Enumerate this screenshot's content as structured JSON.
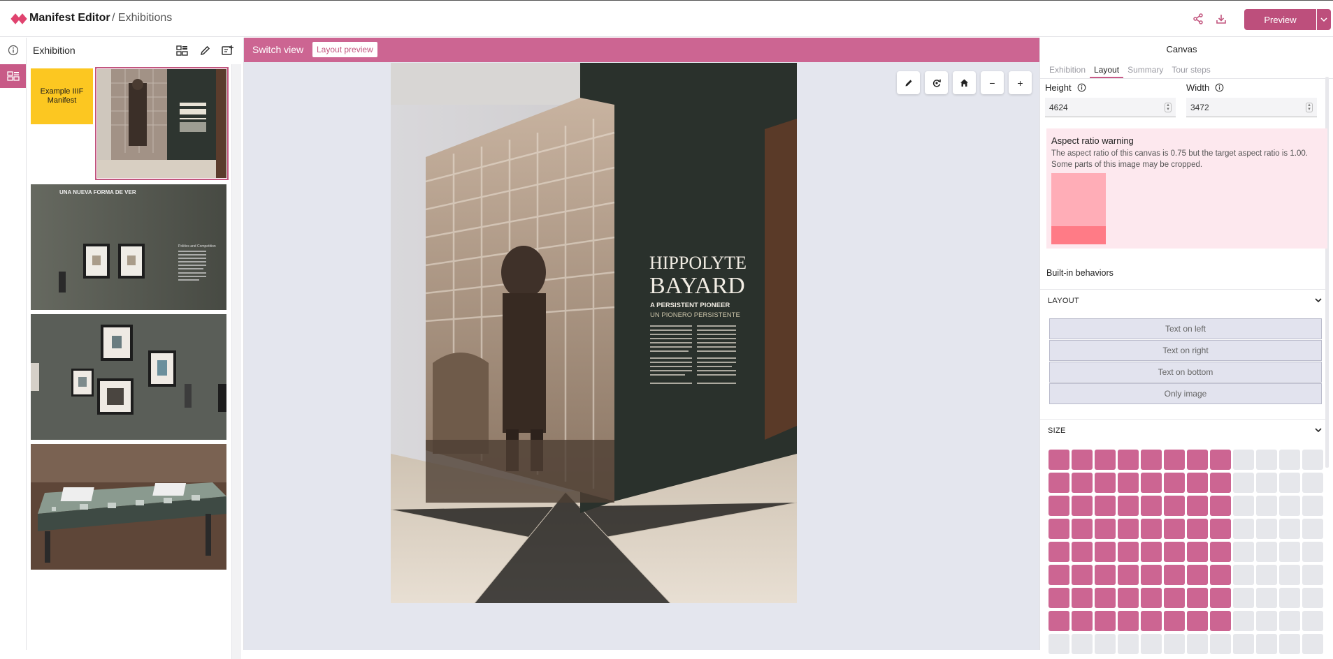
{
  "header": {
    "app_title": "Manifest Editor",
    "breadcrumb": "/ Exhibitions",
    "share_icon": "share-icon",
    "download_icon": "download-icon",
    "preview_label": "Preview",
    "accent": "#bd4f7c"
  },
  "rail": {
    "info_icon": "info-icon",
    "grid_icon": "grid-icon"
  },
  "left_panel": {
    "title": "Exhibition",
    "manifest_card_label": "Example IIIF Manifest",
    "manifest_card_color": "#fcc721",
    "thumbnails": [
      {
        "name": "hippolyte-bayard-wall"
      },
      {
        "name": "una-nueva-forma-de-ver-wall"
      },
      {
        "name": "framed-prints-wall"
      },
      {
        "name": "display-case"
      }
    ],
    "thumb2_text": {
      "line1": "UNA NUEVA FORMA DE VER",
      "line2": "Politics and Competition"
    }
  },
  "canvas": {
    "switch_view": "Switch view",
    "layout_preview": "Layout preview",
    "photo_text": {
      "line1": "HIPPOLYTE",
      "line2": "BAYARD",
      "line3": "A PERSISTENT PIONEER",
      "line4": "UN PIONERO PERSISTENTE"
    },
    "tools": [
      "edit-icon",
      "rotate-icon",
      "home-icon",
      "zoom-out-icon",
      "zoom-in-icon"
    ],
    "zoom_out_glyph": "−",
    "zoom_in_glyph": "+"
  },
  "right_panel": {
    "title": "Canvas",
    "tabs": [
      {
        "label": "Exhibition",
        "active": false
      },
      {
        "label": "Layout",
        "active": true
      },
      {
        "label": "Summary",
        "active": false
      },
      {
        "label": "Tour steps",
        "active": false
      }
    ],
    "height_label": "Height",
    "height_value": "4624",
    "width_label": "Width",
    "width_value": "3472",
    "warning_title": "Aspect ratio warning",
    "warning_text": "The aspect ratio of this canvas is 0.75 but the target aspect ratio is 1.00. Some parts of this image may be cropped.",
    "built_in_title": "Built-in behaviors",
    "layout_section": "LAYOUT",
    "layout_options": [
      "Text on left",
      "Text on right",
      "Text on bottom",
      "Only image"
    ],
    "size_section": "SIZE",
    "size_grid": {
      "columns": 12,
      "rows_visible": 9,
      "selected_columns": 8,
      "selected_rows": 8
    }
  }
}
